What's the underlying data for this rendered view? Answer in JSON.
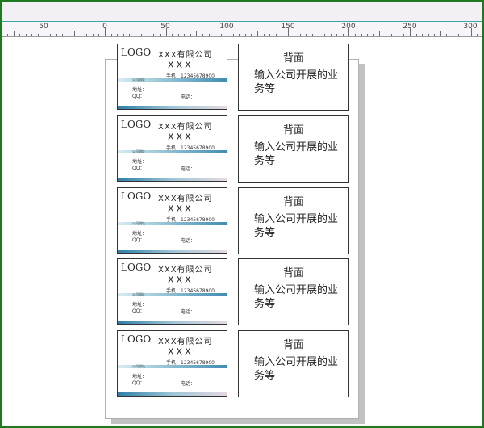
{
  "ruler": {
    "labels": [
      "50",
      "0",
      "50",
      "100",
      "150",
      "200",
      "250",
      "300"
    ]
  },
  "cards": [
    {
      "front": {
        "logo": "LOGO",
        "company": "XXX有限公司",
        "name": "XXX",
        "phone": "手机：12345678900",
        "website": "公司网址",
        "address": "地址：",
        "qq": "QQ：",
        "tel": "电话："
      },
      "back": {
        "title": "背面",
        "desc": "输入公司开展的业务等"
      }
    },
    {
      "front": {
        "logo": "LOGO",
        "company": "XXX有限公司",
        "name": "XXX",
        "phone": "手机：12345678900",
        "website": "公司网址",
        "address": "地址：",
        "qq": "QQ：",
        "tel": "电话："
      },
      "back": {
        "title": "背面",
        "desc": "输入公司开展的业务等"
      }
    },
    {
      "front": {
        "logo": "LOGO",
        "company": "XXX有限公司",
        "name": "XXX",
        "phone": "手机：12345678900",
        "website": "公司网址",
        "address": "地址：",
        "qq": "QQ：",
        "tel": "电话："
      },
      "back": {
        "title": "背面",
        "desc": "输入公司开展的业务等"
      }
    },
    {
      "front": {
        "logo": "LOGO",
        "company": "XXX有限公司",
        "name": "XXX",
        "phone": "手机：12345678900",
        "website": "公司网址",
        "address": "地址：",
        "qq": "QQ：",
        "tel": "电话："
      },
      "back": {
        "title": "背面",
        "desc": "输入公司开展的业务等"
      }
    },
    {
      "front": {
        "logo": "LOGO",
        "company": "XXX有限公司",
        "name": "XXX",
        "phone": "手机：12345678900",
        "website": "公司网址",
        "address": "地址：",
        "qq": "QQ：",
        "tel": "电话："
      },
      "back": {
        "title": "背面",
        "desc": "输入公司开展的业务等"
      }
    }
  ],
  "colors": {
    "window_border": "#1f7a1f",
    "accent_band": "#3e8bb0",
    "ruler_bg": "#f7f5fa"
  }
}
